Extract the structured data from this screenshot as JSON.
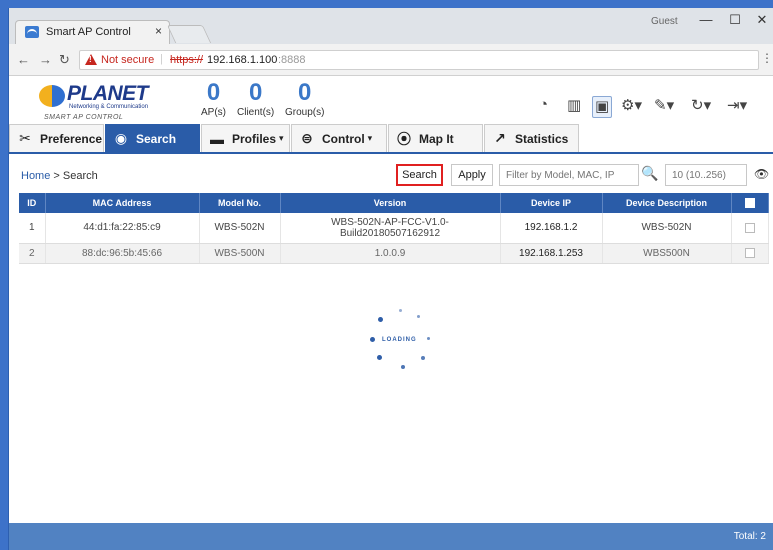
{
  "browser": {
    "tab_title": "Smart AP Control",
    "tab_close": "×",
    "guest": "Guest",
    "window_min": "—",
    "window_max": "☐",
    "window_close": "✕",
    "not_secure": "Not secure",
    "url_scheme": "https://",
    "url_host": "192.168.1.100",
    "url_port": ":8888"
  },
  "header": {
    "logo_text": "PLANET",
    "logo_sub": "Networking & Communication",
    "logo_tag": "SMART AP CONTROL",
    "counters": [
      {
        "value": "0",
        "label": "AP(s)"
      },
      {
        "value": "0",
        "label": "Client(s)"
      },
      {
        "value": "0",
        "label": "Group(s)"
      }
    ]
  },
  "nav": [
    {
      "label": "Preference",
      "icon": "tools-icon"
    },
    {
      "label": "Search",
      "icon": "search-globe-icon"
    },
    {
      "label": "Profiles",
      "icon": "folder-icon"
    },
    {
      "label": "Control",
      "icon": "steering-icon"
    },
    {
      "label": "Map It",
      "icon": "map-pin-icon"
    },
    {
      "label": "Statistics",
      "icon": "chart-arrow-icon"
    }
  ],
  "breadcrumb": {
    "home": "Home",
    "separator": " > ",
    "current": "Search"
  },
  "toolbar": {
    "search_label": "Search",
    "apply_label": "Apply",
    "filter_placeholder": "Filter by Model, MAC, IP",
    "range_placeholder": "10 (10..256)"
  },
  "table": {
    "headers": [
      "ID",
      "MAC Address",
      "Model No.",
      "Version",
      "Device IP",
      "Device Description"
    ],
    "rows": [
      {
        "id": "1",
        "mac": "44:d1:fa:22:85:c9",
        "model": "WBS-502N",
        "version": "WBS-502N-AP-FCC-V1.0-Build20180507162912",
        "ip": "192.168.1.2",
        "desc": "WBS-502N"
      },
      {
        "id": "2",
        "mac": "88:dc:96:5b:45:66",
        "model": "WBS-500N",
        "version": "1.0.0.9",
        "ip": "192.168.1.253",
        "desc": "WBS500N"
      }
    ]
  },
  "loading": {
    "text": "LOADING"
  },
  "footer": {
    "total": "Total: 2"
  }
}
